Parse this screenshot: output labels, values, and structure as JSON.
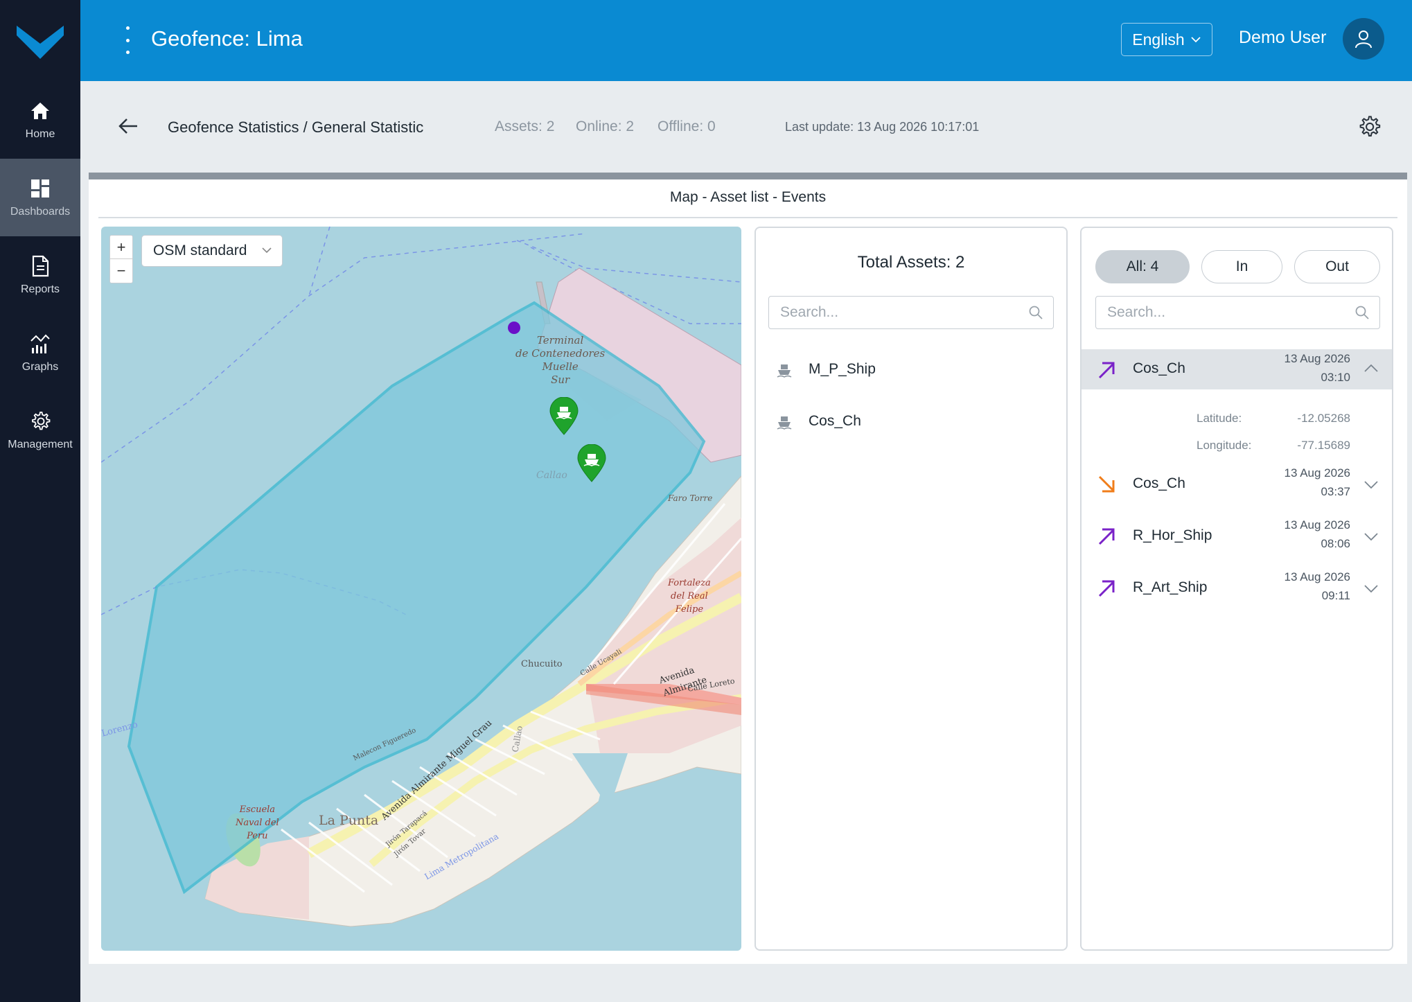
{
  "nav": {
    "items": [
      {
        "label": "Home",
        "icon": "home-icon"
      },
      {
        "label": "Dashboards",
        "icon": "dashboards-icon"
      },
      {
        "label": "Reports",
        "icon": "reports-icon"
      },
      {
        "label": "Graphs",
        "icon": "graphs-icon"
      },
      {
        "label": "Management",
        "icon": "gear-icon"
      }
    ],
    "active": "Dashboards"
  },
  "header": {
    "title": "Geofence: Lima",
    "language": "English",
    "user": "Demo User",
    "brand_color": "#0a8ad2"
  },
  "subheader": {
    "breadcrumb": "Geofence Statistics / General Statistic",
    "assets": "Assets: 2",
    "online": "Online: 2",
    "offline": "Offline: 0",
    "last_update": "Last update: 13 Aug 2026 10:17:01"
  },
  "card": {
    "title": "Map - Asset list - Events"
  },
  "map": {
    "zoom_in": "+",
    "zoom_out": "−",
    "layer": "OSM standard",
    "labels": {
      "terminal": [
        "Terminal",
        "de Contenedores",
        "Muelle",
        "Sur"
      ],
      "callao": "Callao",
      "faro": "Faro Torre",
      "fortaleza": [
        "Fortaleza",
        "del Real",
        "Felipe"
      ],
      "avenida_almirante": "Avenida Almirante",
      "calle_loreto": "Calle Loreto",
      "chucuito": "Chucuito",
      "calle_ucayali": "Calle Ucayali",
      "la_punta": "La Punta",
      "malecon": "Malecon Figueredo",
      "av_miguel_grau": "Avenida Almirante Miguel Grau",
      "naval": [
        "Escuela",
        "Naval del",
        "Peru"
      ],
      "lorenzo": "Lorenzo",
      "lima_metropolitana": "Lima Metropolitana",
      "callao_road": "Callao",
      "jiron_tarapaca": "Jirón Tarapacá",
      "jiron_tovar": "Jirón Tovar"
    },
    "geofence_color": "#3bb8d0",
    "marker_color": "#1fa32c",
    "point_color": "#6a10c8"
  },
  "assets_panel": {
    "title": "Total Assets: 2",
    "search_placeholder": "Search...",
    "items": [
      {
        "name": "M_P_Ship",
        "icon": "ship-icon"
      },
      {
        "name": "Cos_Ch",
        "icon": "ship-icon"
      }
    ]
  },
  "events_panel": {
    "filters": {
      "all": "All: 4",
      "in": "In",
      "out": "Out"
    },
    "search_placeholder": "Search...",
    "events": [
      {
        "name": "Cos_Ch",
        "date": "13 Aug 2026",
        "time": "03:10",
        "direction": "in",
        "expanded": true,
        "details": {
          "lat_label": "Latitude:",
          "lat": "-12.05268",
          "lon_label": "Longitude:",
          "lon": "-77.15689"
        }
      },
      {
        "name": "Cos_Ch",
        "date": "13 Aug 2026",
        "time": "03:37",
        "direction": "out",
        "expanded": false
      },
      {
        "name": "R_Hor_Ship",
        "date": "13 Aug 2026",
        "time": "08:06",
        "direction": "in",
        "expanded": false
      },
      {
        "name": "R_Art_Ship",
        "date": "13 Aug 2026",
        "time": "09:11",
        "direction": "in",
        "expanded": false
      }
    ],
    "in_color": "#7a22c8",
    "out_color": "#f07d1a"
  }
}
